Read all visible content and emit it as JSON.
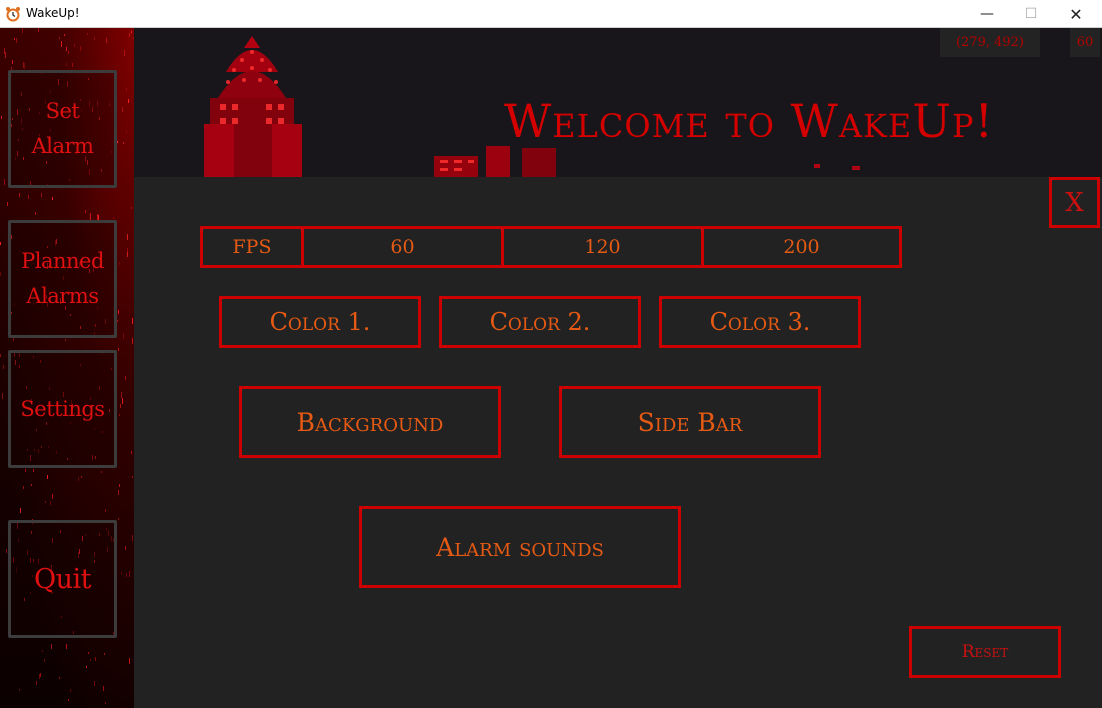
{
  "window": {
    "title": "WakeUp!",
    "minimize_glyph": "—",
    "maximize_glyph": "☐",
    "close_glyph": "✕"
  },
  "sidebar": {
    "items": [
      {
        "label_line1": "Set",
        "label_line2": "Alarm"
      },
      {
        "label_line1": "Planned",
        "label_line2": "Alarms"
      },
      {
        "label_line1": "Settings"
      },
      {
        "label_line1": "Quit"
      }
    ]
  },
  "header": {
    "welcome": "Welcome to WakeUp!",
    "mouse_coords": "(279, 492)",
    "fps_readout": "60"
  },
  "settings": {
    "close_label": "X",
    "fps": {
      "label": "FPS",
      "options": [
        "60",
        "120",
        "200"
      ]
    },
    "colors": [
      "Color 1.",
      "Color 2.",
      "Color 3."
    ],
    "background_label": "Background",
    "sidebar_label": "Side Bar",
    "alarm_sounds_label": "Alarm sounds",
    "reset_label": "Reset"
  },
  "theme": {
    "accent": "#cc0000",
    "text_orange": "#e65a14",
    "panel_bg": "#222222",
    "header_bg": "#18161b"
  }
}
